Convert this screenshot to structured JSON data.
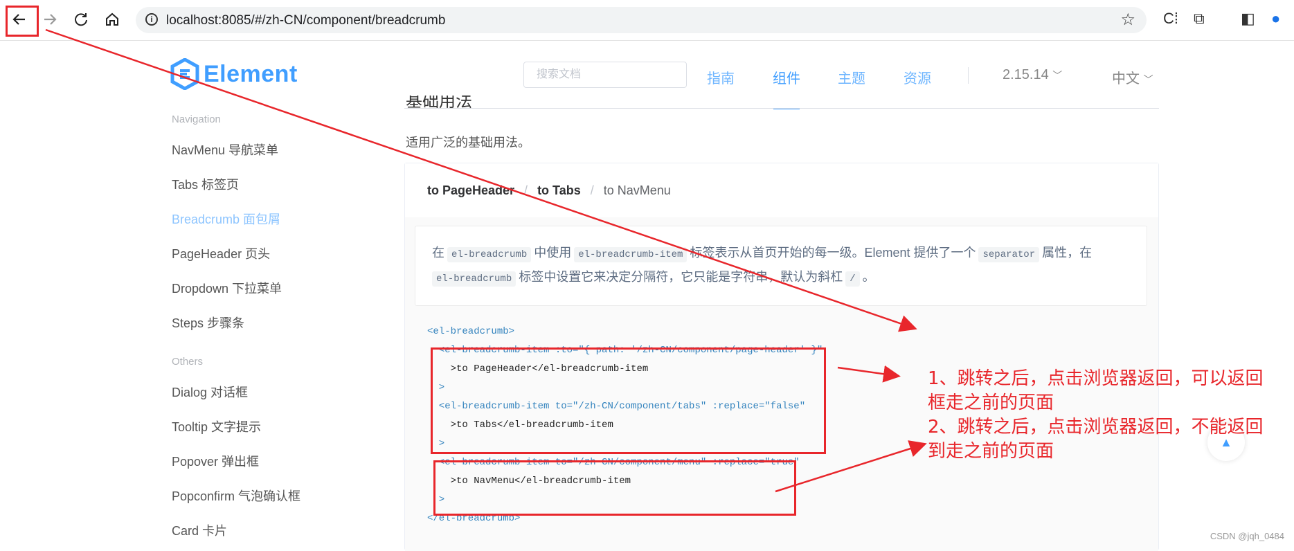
{
  "browser": {
    "url": "localhost:8085/#/zh-CN/component/breadcrumb"
  },
  "header": {
    "logo_text": "Element",
    "search_placeholder": "搜索文档",
    "nav": [
      "指南",
      "组件",
      "主题",
      "资源"
    ],
    "active_nav": "组件",
    "version": "2.15.14",
    "language": "中文"
  },
  "sidebar": {
    "group_navigation": "Navigation",
    "nav_items": [
      {
        "label": "NavMenu 导航菜单"
      },
      {
        "label": "Tabs 标签页"
      },
      {
        "label": "Breadcrumb 面包屑"
      },
      {
        "label": "PageHeader 页头"
      },
      {
        "label": "Dropdown 下拉菜单"
      },
      {
        "label": "Steps 步骤条"
      }
    ],
    "active_item": "Breadcrumb 面包屑",
    "group_others": "Others",
    "other_items": [
      {
        "label": "Dialog 对话框"
      },
      {
        "label": "Tooltip 文字提示"
      },
      {
        "label": "Popover 弹出框"
      },
      {
        "label": "Popconfirm 气泡确认框"
      },
      {
        "label": "Card 卡片"
      }
    ]
  },
  "main": {
    "section_title": "基础用法",
    "section_desc": "适用广泛的基础用法。",
    "breadcrumb": [
      "to PageHeader",
      "to Tabs",
      "to NavMenu"
    ],
    "breadcrumb_separator": "/",
    "description": {
      "p1": "在",
      "code1": "el-breadcrumb",
      "p2": "中使用",
      "code2": "el-breadcrumb-item",
      "p3": "标签表示从首页开始的每一级。Element 提供了一个",
      "code3": "separator",
      "p4": "属性，在",
      "code4": "el-breadcrumb",
      "p5": "标签中设置它来决定分隔符，它只能是字符串，默认为斜杠",
      "code5": "/",
      "p6": "。"
    },
    "code_lines": [
      "<el-breadcrumb>",
      "  <el-breadcrumb-item :to=\"{ path: '/zh-CN/component/page-header' }\"",
      "    >to PageHeader</el-breadcrumb-item",
      "  >",
      "  <el-breadcrumb-item to=\"/zh-CN/component/tabs\" :replace=\"false\"",
      "    >to Tabs</el-breadcrumb-item",
      "  >",
      "  <el-breadcrumb-item to=\"/zh-CN/component/menu\" :replace=\"true\"",
      "    >to NavMenu</el-breadcrumb-item",
      "  >",
      "</el-breadcrumb>"
    ]
  },
  "annotation": {
    "line1": "1、跳转之后，点击浏览器返回，可以返回",
    "line2": "框走之前的页面",
    "line3": "2、跳转之后，点击浏览器返回，不能返回",
    "line4": "到走之前的页面",
    "color": "#e8262b"
  },
  "watermark": "CSDN @jqh_0484",
  "colors": {
    "accent": "#409eff",
    "annotation": "#e8262b"
  }
}
